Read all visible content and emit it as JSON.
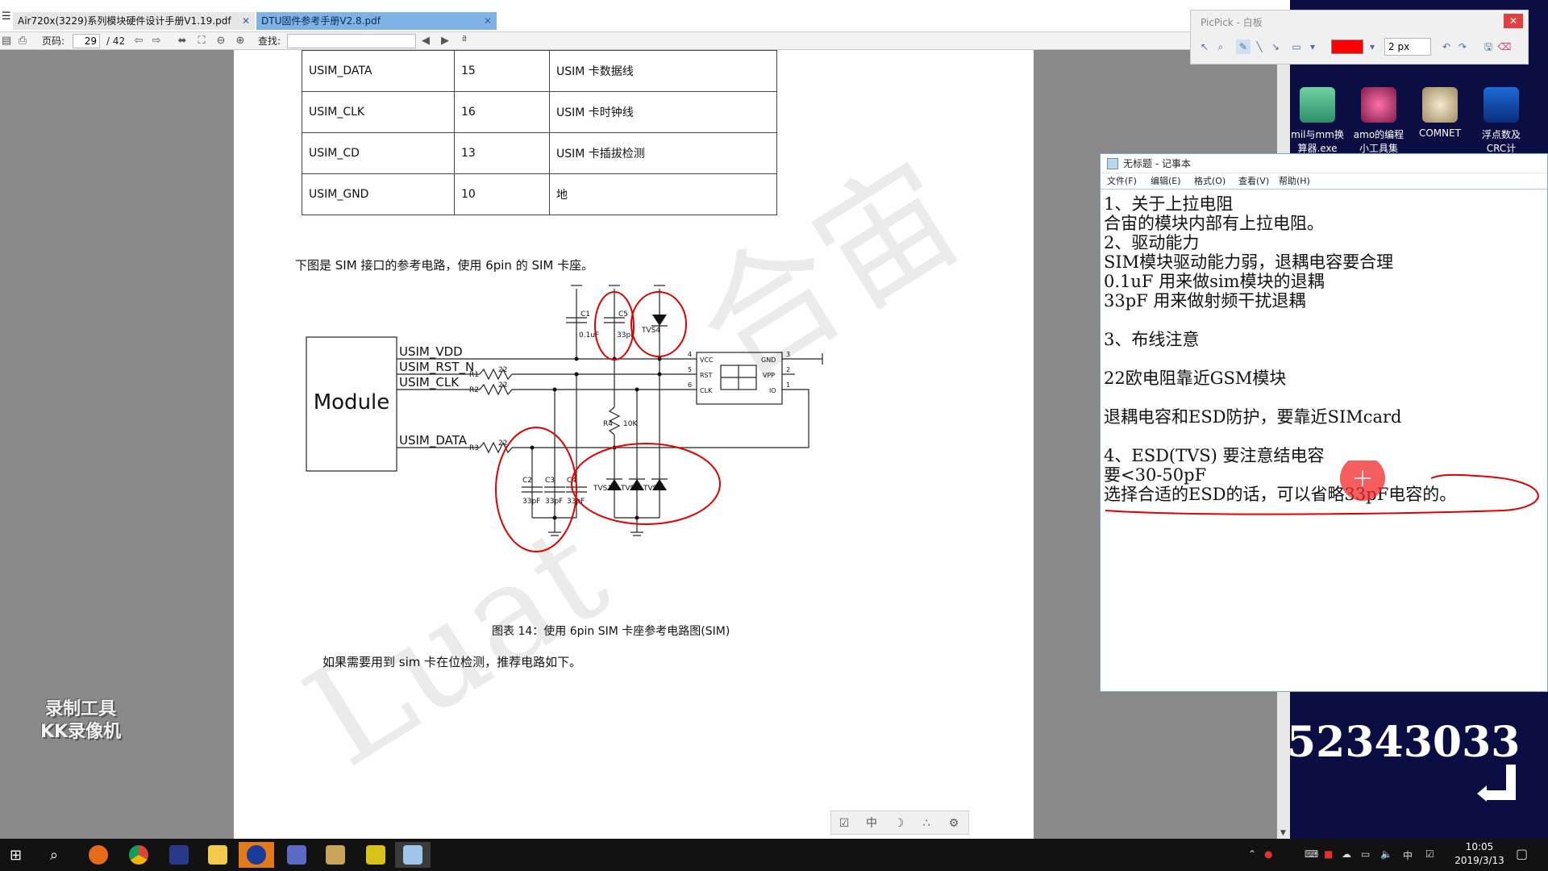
{
  "tabs": [
    {
      "label": "Air720x(3229)系列模块硬件设计手册V1.19.pdf"
    },
    {
      "label": "DTU固件参考手册V2.8.pdf"
    }
  ],
  "toolbar": {
    "page_label": "页码:",
    "page_current": "29",
    "page_total": "/ 42",
    "find_label": "查找:"
  },
  "pin_table": [
    {
      "name": "USIM_DATA",
      "pin": "15",
      "desc": "USIM 卡数据线"
    },
    {
      "name": "USIM_CLK",
      "pin": "16",
      "desc": "USIM 卡时钟线"
    },
    {
      "name": "USIM_CD",
      "pin": "13",
      "desc": "USIM 卡插拔检测"
    },
    {
      "name": "USIM_GND",
      "pin": "10",
      "desc": "地"
    }
  ],
  "doc": {
    "intro": "下图是 SIM 接口的参考电路，使用 6pin 的 SIM 卡座。",
    "caption": "图表 14：使用 6pin SIM 卡座参考电路图(SIM)",
    "next": "如果需要用到 sim 卡在位检测，推荐电路如下。"
  },
  "schematic": {
    "module": "Module",
    "nets": [
      "USIM_VDD",
      "USIM_RST_N",
      "USIM_CLK",
      "USIM_DATA"
    ],
    "resistors": [
      {
        "ref": "R1",
        "val": "22"
      },
      {
        "ref": "R2",
        "val": "22"
      },
      {
        "ref": "R3",
        "val": "22"
      }
    ],
    "r4": {
      "ref": "R4",
      "val": "10K"
    },
    "caps_top": [
      {
        "ref": "C1",
        "val": "0.1uF"
      },
      {
        "ref": "C5",
        "val": "33pF"
      }
    ],
    "caps_bottom": [
      {
        "ref": "C2",
        "val": "33pF"
      },
      {
        "ref": "C3",
        "val": "33pF"
      },
      {
        "ref": "C4",
        "val": "33pF"
      }
    ],
    "tvs_top": "TVS4",
    "tvs_bottom": [
      "TVS1",
      "TVS2",
      "TVS3"
    ],
    "sim_left_pins": [
      {
        "num": "4",
        "name": "VCC"
      },
      {
        "num": "5",
        "name": "RST"
      },
      {
        "num": "6",
        "name": "CLK"
      }
    ],
    "sim_right_pins": [
      {
        "num": "3",
        "name": "GND"
      },
      {
        "num": "2",
        "name": "VPP"
      },
      {
        "num": "1",
        "name": "IO"
      }
    ]
  },
  "picpick": {
    "title": "PicPick - 白板",
    "close": "✕",
    "size": "2 px",
    "color": "#ff0000"
  },
  "desktop_icons": [
    {
      "label": "mil与mm换算器.exe"
    },
    {
      "label": "amo的编程小工具集"
    },
    {
      "label": "COMNET"
    },
    {
      "label": "浮点数及CRC计算.exe"
    }
  ],
  "big_number": "52343033",
  "notepad": {
    "title": "无标题 - 记事本",
    "menu": [
      "文件(F)",
      "编辑(E)",
      "格式(O)",
      "查看(V)",
      "帮助(H)"
    ],
    "lines": [
      "1、关于上拉电阻",
      "合宙的模块内部有上拉电阻。",
      "2、驱动能力",
      "SIM模块驱动能力弱，退耦电容要合理",
      "0.1uF 用来做sim模块的退耦",
      "33pF 用来做射频干扰退耦",
      "",
      "3、布线注意",
      "",
      "22欧电阻靠近GSM模块",
      "",
      "退耦电容和ESD防护，要靠近SIMcard",
      "",
      "4、ESD(TVS) 要注意结电容",
      "要<30-50pF",
      "选择合适的ESD的话，可以省略33pF电容的。"
    ]
  },
  "recorder": {
    "line1": "录制工具",
    "line2": "KK录像机"
  },
  "clock": {
    "time": "10:05",
    "date": "2019/3/13"
  },
  "tray": {
    "ime": "中"
  },
  "page_tools": {
    "lang": "中"
  }
}
